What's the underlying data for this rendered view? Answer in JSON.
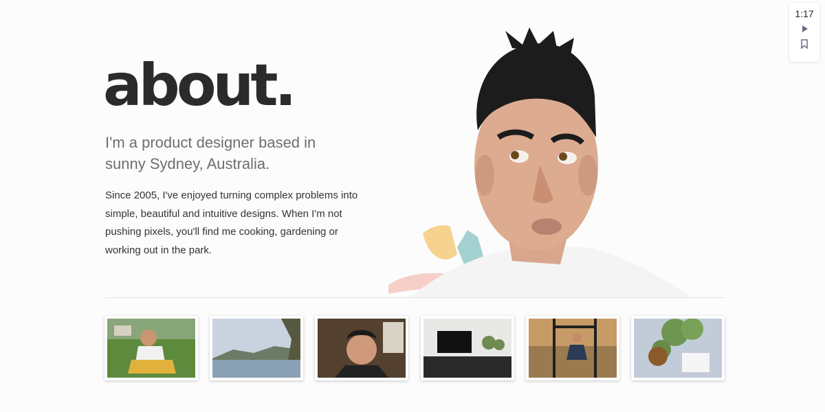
{
  "about": {
    "title": "about.",
    "lead": "I'm a product designer based in sunny Sydney, Australia.",
    "body": "Since 2005, I've enjoyed turning complex problems into simple, beautiful and intuitive designs. When I'm not pushing pixels, you'll find me cooking, gardening or working out in the park."
  },
  "widget": {
    "time": "1:17",
    "icons": [
      "play-icon",
      "bookmark-icon"
    ]
  },
  "gallery": {
    "photos": [
      "photo-child-on-toy",
      "photo-sydney-harbour",
      "photo-selfie",
      "photo-desk-setup",
      "photo-park-workout",
      "photo-potted-plant"
    ]
  },
  "colors": {
    "title": "#2b2b2b",
    "lead": "#6e6e6e",
    "body": "#333333",
    "background": "#fcfcfc"
  }
}
